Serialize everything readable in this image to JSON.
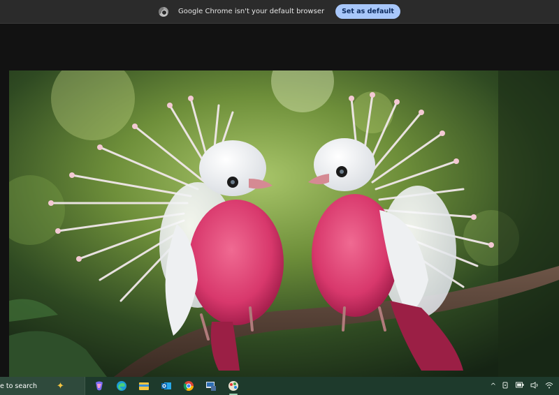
{
  "infobar": {
    "message": "Google Chrome isn't your default browser",
    "button_label": "Set as default"
  },
  "taskbar": {
    "search_text": "e to search",
    "apps": [
      "copilot-icon",
      "edge-icon",
      "file-explorer-icon",
      "outlook-icon",
      "chrome-icon",
      "remote-desktop-icon",
      "paint-app-icon"
    ],
    "tray": [
      "chevron-up-icon",
      "meet-icon",
      "battery-icon",
      "volume-icon",
      "wifi-icon"
    ]
  },
  "colors": {
    "infobar_bg": "#2b2b2b",
    "button_bg": "#a8c7fa",
    "taskbar_bg": "#1e3a2c"
  }
}
